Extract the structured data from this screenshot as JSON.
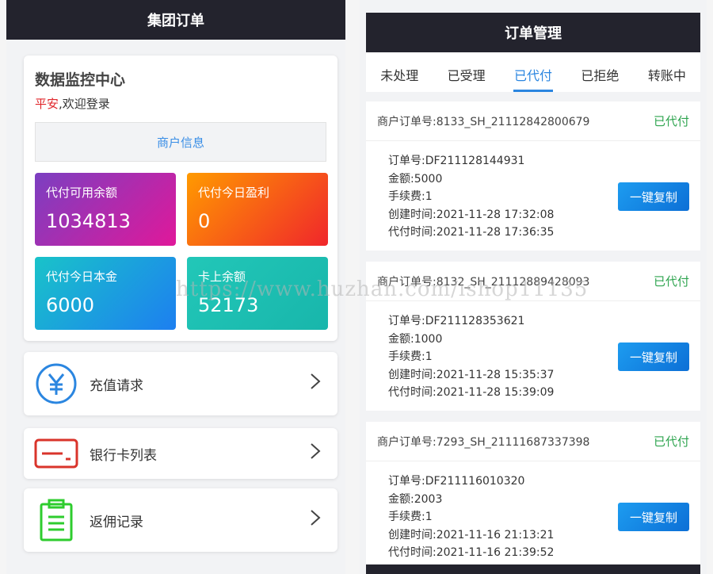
{
  "left": {
    "header_title": "集团订单",
    "monitor_title": "数据监控中心",
    "welcome_user": "平安",
    "welcome_text": ",欢迎登录",
    "merchant_info_label": "商户信息",
    "stats": [
      {
        "label": "代付可用余额",
        "value": "1034813"
      },
      {
        "label": "代付今日盈利",
        "value": "0"
      },
      {
        "label": "代付今日本金",
        "value": "6000"
      },
      {
        "label": "卡上余额",
        "value": "52173"
      }
    ],
    "menu": [
      {
        "label": "充值请求",
        "icon": "yuan-icon"
      },
      {
        "label": "银行卡列表",
        "icon": "bank-card-icon"
      },
      {
        "label": "返佣记录",
        "icon": "clipboard-icon"
      }
    ]
  },
  "right": {
    "header_title": "订单管理",
    "tabs": [
      "未处理",
      "已受理",
      "已代付",
      "已拒绝",
      "转账中"
    ],
    "active_tab": "已代付",
    "copy_label": "一键复制",
    "orders": [
      {
        "merchant_no": "商户订单号:8133_SH_21112842800679",
        "status": "已代付",
        "order_no": "订单号:DF211128144931",
        "amount": "金额:5000",
        "fee": "手续费:1",
        "created": "创建时间:2021-11-28 17:32:08",
        "paid": "代付时间:2021-11-28 17:36:35"
      },
      {
        "merchant_no": "商户订单号:8132_SH_21112889428093",
        "status": "已代付",
        "order_no": "订单号:DF211128353621",
        "amount": "金额:1000",
        "fee": "手续费:1",
        "created": "创建时间:2021-11-28 15:35:37",
        "paid": "代付时间:2021-11-28 15:39:09"
      },
      {
        "merchant_no": "商户订单号:7293_SH_21111687337398",
        "status": "已代付",
        "order_no": "订单号:DF211116010320",
        "amount": "金额:2003",
        "fee": "手续费:1",
        "created": "创建时间:2021-11-16 21:13:21",
        "paid": "代付时间:2021-11-16 21:39:52"
      }
    ]
  },
  "watermark": "https://www.huzhan.com/ishop11135",
  "colors": {
    "header_bg": "#23232d",
    "accent_blue": "#2b86e0",
    "status_green": "#2ea44f",
    "welcome_red": "#e0262b"
  }
}
